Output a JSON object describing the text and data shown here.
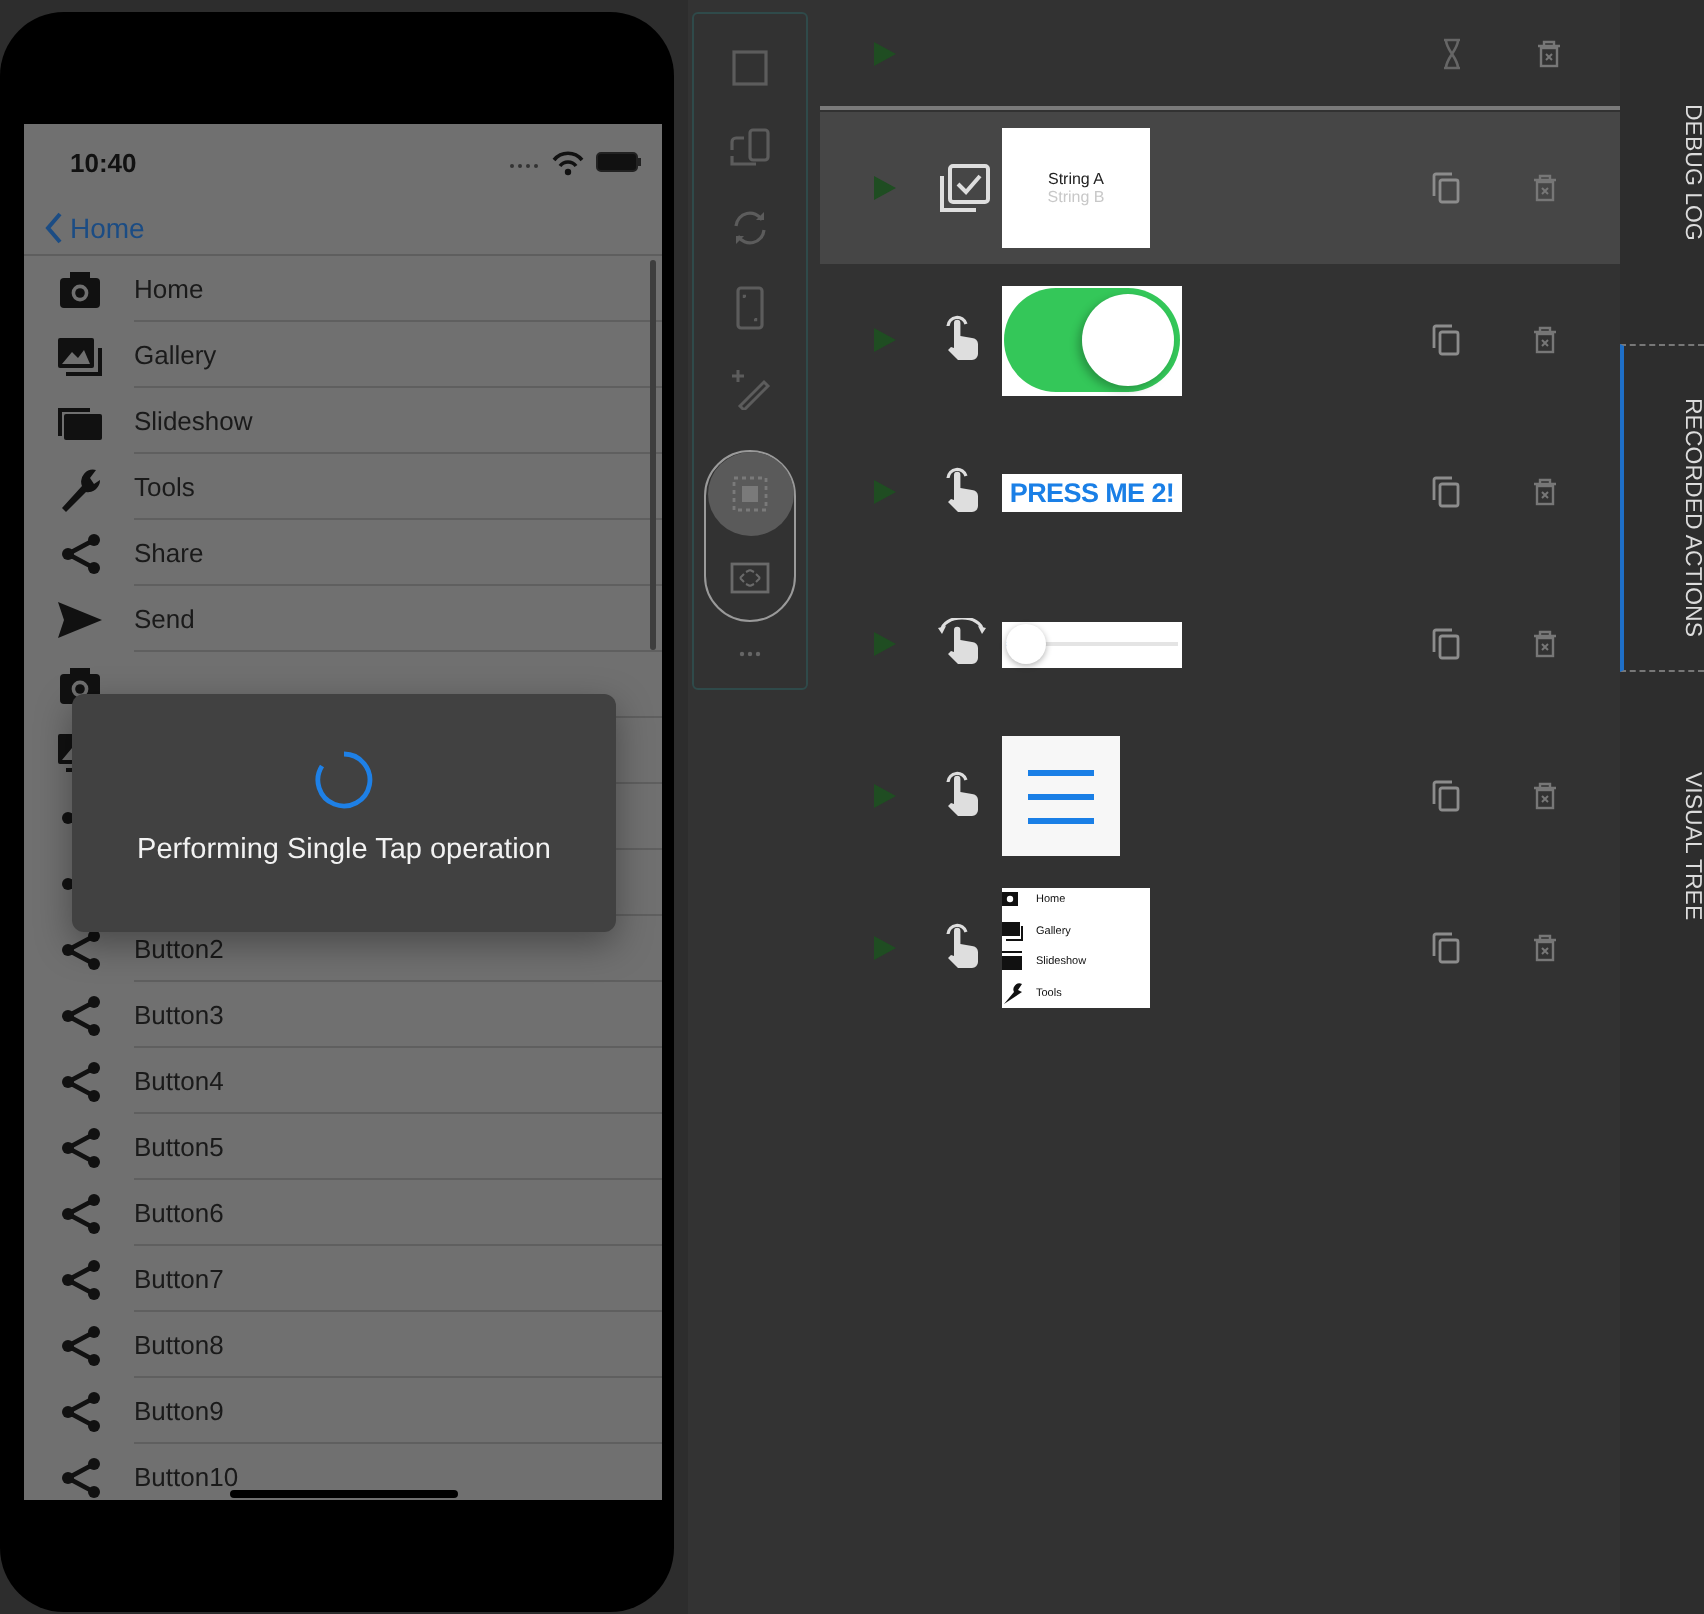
{
  "phone": {
    "status_bar": {
      "time": "10:40"
    },
    "nav": {
      "back_label": "Home"
    },
    "rows": [
      {
        "kind": "camera",
        "label": "Home"
      },
      {
        "kind": "gallery",
        "label": "Gallery"
      },
      {
        "kind": "slideshow",
        "label": "Slideshow"
      },
      {
        "kind": "wrench",
        "label": "Tools"
      },
      {
        "kind": "share",
        "label": "Share"
      },
      {
        "kind": "send",
        "label": "Send"
      },
      {
        "kind": "camera"
      },
      {
        "kind": "gallery"
      },
      {
        "kind": "share"
      },
      {
        "kind": "share"
      },
      {
        "kind": "share",
        "label": "Button2"
      },
      {
        "kind": "share",
        "label": "Button3"
      },
      {
        "kind": "share",
        "label": "Button4"
      },
      {
        "kind": "share",
        "label": "Button5"
      },
      {
        "kind": "share",
        "label": "Button6"
      },
      {
        "kind": "share",
        "label": "Button7"
      },
      {
        "kind": "share",
        "label": "Button8"
      },
      {
        "kind": "share",
        "label": "Button9"
      },
      {
        "kind": "share",
        "label": "Button10"
      }
    ],
    "toast": {
      "message": "Performing Single Tap operation"
    }
  },
  "toolbar": {
    "modes": [
      {
        "selected": true
      },
      {
        "selected": false
      }
    ]
  },
  "actions": [
    {
      "kind": "multi-select",
      "selected": true,
      "thumbnail": {
        "kind": "label",
        "lines": [
          "String A",
          "String B"
        ]
      }
    },
    {
      "kind": "tap",
      "selected": false,
      "thumbnail": {
        "kind": "switch",
        "on": true
      }
    },
    {
      "kind": "tap",
      "selected": false,
      "thumbnail": {
        "kind": "button",
        "text": "PRESS ME 2!"
      }
    },
    {
      "kind": "rotate",
      "selected": false,
      "thumbnail": {
        "kind": "slider",
        "level": 0.12
      }
    },
    {
      "kind": "tap",
      "selected": false,
      "thumbnail": {
        "kind": "menu"
      }
    },
    {
      "kind": "tap",
      "selected": false,
      "thumbnail": {
        "kind": "list",
        "items": [
          "Home",
          "Gallery",
          "Slideshow",
          "Tools"
        ]
      }
    }
  ],
  "side_tabs": [
    {
      "label": "DEBUG LOG",
      "selected": false
    },
    {
      "label": "RECORDED ACTIONS",
      "selected": true
    },
    {
      "label": "VISUAL TREE",
      "selected": false
    }
  ]
}
